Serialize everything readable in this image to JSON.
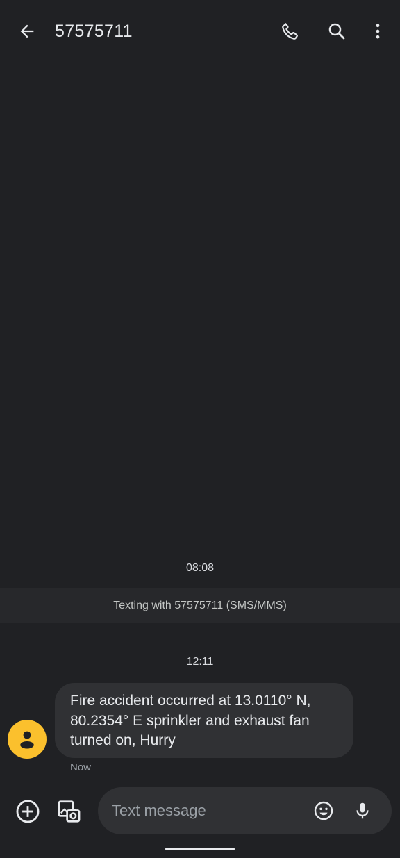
{
  "header": {
    "title": "57575711",
    "icons": {
      "back": "arrow-back-icon",
      "call": "phone-icon",
      "search": "search-icon",
      "more": "more-vert-icon"
    }
  },
  "conversation": {
    "first_timestamp": "08:08",
    "info_banner": "Texting with 57575711 (SMS/MMS)",
    "second_timestamp": "12:11",
    "messages": [
      {
        "text": "Fire accident occurred at 13.0110° N, 80.2354° E sprinkler and exhaust fan turned on, Hurry",
        "status": "Now",
        "avatar": "person-icon",
        "avatar_color": "#fbc02d"
      }
    ]
  },
  "composer": {
    "placeholder": "Text message",
    "value": "",
    "icons": {
      "add": "add-circle-icon",
      "gallery": "gallery-camera-icon",
      "emoji": "emoji-icon",
      "mic": "mic-icon"
    }
  },
  "colors": {
    "background": "#202124",
    "bubble": "#303134",
    "banner": "#27282b",
    "text": "#e8eaed",
    "secondary_text": "#9aa0a6"
  }
}
